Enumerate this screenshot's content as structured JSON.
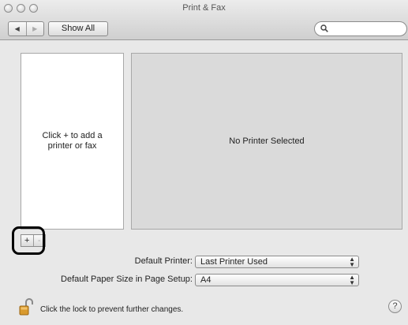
{
  "window": {
    "title": "Print & Fax"
  },
  "toolbar": {
    "back_icon": "triangle-left",
    "forward_icon": "triangle-right",
    "show_all_label": "Show All",
    "search_placeholder": ""
  },
  "printer_list": {
    "empty_text": "Click + to add a printer or fax"
  },
  "detail": {
    "empty_text": "No Printer Selected"
  },
  "list_controls": {
    "add_label": "+",
    "remove_label": "-"
  },
  "settings": {
    "default_printer_label": "Default Printer:",
    "default_printer_value": "Last Printer Used",
    "paper_size_label": "Default Paper Size in Page Setup:",
    "paper_size_value": "A4"
  },
  "footer": {
    "lock_text": "Click the lock to prevent further changes.",
    "help_label": "?"
  }
}
